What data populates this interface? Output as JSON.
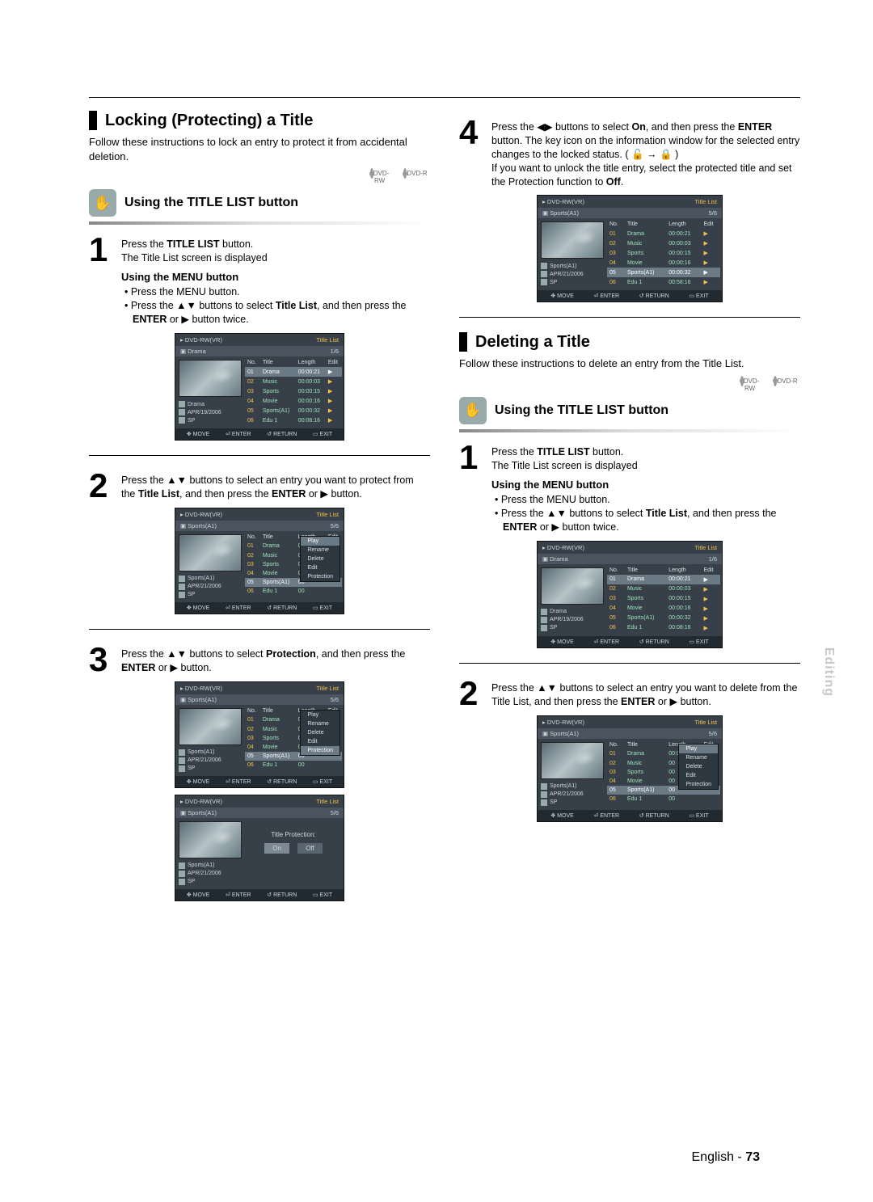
{
  "page": {
    "lang": "English",
    "num": "73",
    "side_tab": "Editing"
  },
  "sections": {
    "locking": {
      "title": "Locking (Protecting) a Title",
      "intro": "Follow these instructions to lock an entry to protect it from accidental deletion."
    },
    "deleting": {
      "title": "Deleting a Title",
      "intro": "Follow these instructions to delete an entry from the Title List."
    }
  },
  "disc_labels": {
    "rw": "DVD-RW",
    "r": "DVD-R"
  },
  "using_title_list": "Using the TITLE LIST button",
  "using_menu": "Using the MENU button",
  "bullets": {
    "press_menu": "• Press the MENU button.",
    "press_title_list_b1": "• Press the ▲▼ buttons to select ",
    "press_title_list_b2": "Title List",
    "press_title_list_b3": ", and then press the ",
    "press_title_list_b4": "ENTER",
    "press_title_list_b5": " or ▶ button twice."
  },
  "steps": {
    "s1": {
      "num": "1",
      "a": "Press the ",
      "b": "TITLE LIST",
      "c": " button.",
      "d": "The Title List screen is displayed"
    },
    "s2": {
      "num": "2",
      "a": "Press the ▲▼ buttons to select an entry you want to protect from the ",
      "b": "Title List",
      "c": ", and then press the ",
      "d": "ENTER",
      "e": " or ▶ button."
    },
    "s3": {
      "num": "3",
      "a": "Press the ▲▼ buttons to select ",
      "b": "Protection",
      "c": ", and then press the ",
      "d": "ENTER",
      "e": " or ▶ button."
    },
    "s4": {
      "num": "4",
      "a": "Press the ◀▶ buttons to select ",
      "b": "On",
      "c": ", and then press the ",
      "d": "ENTER",
      "e": " button. The key icon on the information window for the selected entry changes to the locked status. ( 🔓 → 🔒 )",
      "f": "If you want to unlock the title entry, select the protected title and set the Protection function to ",
      "g": "Off",
      "h": "."
    },
    "s2d": {
      "num": "2",
      "a": "Press the ▲▼ buttons to select an entry you want to delete from the Title List, and then press the ",
      "b": "ENTER",
      "c": " or ▶ button."
    }
  },
  "osd": {
    "header_title": "DVD-RW(VR)",
    "header_right": "Title List",
    "sub_label_drama": "Drama",
    "sub_label_sports": "Sports(A1)",
    "count_1_6": "1/6",
    "count_5_6": "5/6",
    "cols": {
      "no": "No.",
      "title": "Title",
      "length": "Length",
      "edit": "Edit"
    },
    "rows": [
      {
        "no": "01",
        "title": "Drama",
        "length": "00:00:21",
        "edit": "▶"
      },
      {
        "no": "02",
        "title": "Music",
        "length": "00:00:03",
        "edit": "▶"
      },
      {
        "no": "03",
        "title": "Sports",
        "length": "00:00:15",
        "edit": "▶"
      },
      {
        "no": "04",
        "title": "Movie",
        "length": "00:00:16",
        "edit": "▶"
      },
      {
        "no": "05",
        "title": "Sports(A1)",
        "length": "00:00:32",
        "edit": "▶"
      },
      {
        "no": "06",
        "title": "Edu 1",
        "length": "00:08:16",
        "edit": "▶"
      }
    ],
    "row6_alt_length": "00:58:16",
    "meta": {
      "drama": {
        "name": "Drama",
        "date": "APR/19/2006",
        "sp": "SP"
      },
      "sports": {
        "name": "Sports(A1)",
        "date": "APR/21/2006",
        "sp": "SP"
      }
    },
    "foot": {
      "move": "MOVE",
      "enter": "ENTER",
      "return": "RETURN",
      "exit": "EXIT"
    },
    "popup": [
      "Play",
      "Rename",
      "Delete",
      "Edit",
      "Protection"
    ],
    "protection": {
      "label": "Title Protection:",
      "on": "On",
      "off": "Off"
    }
  }
}
